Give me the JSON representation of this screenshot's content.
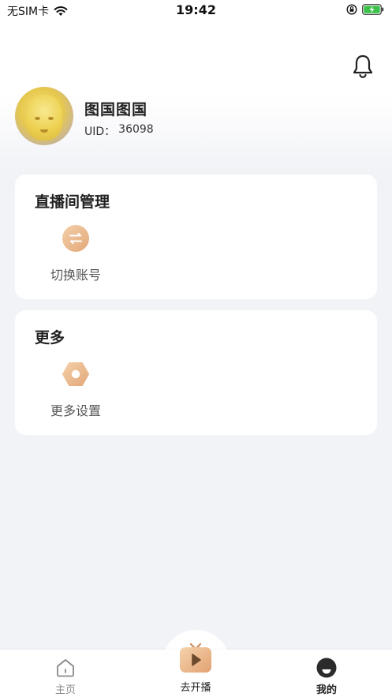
{
  "status_bar": {
    "carrier": "无SIM卡",
    "time": "19:42"
  },
  "profile": {
    "username": "图国图国",
    "uid_label": "UID：",
    "uid_value": "36098"
  },
  "live_management": {
    "title": "直播间管理",
    "items": [
      {
        "label": "切换账号",
        "icon": "switch-account-icon"
      }
    ]
  },
  "more": {
    "title": "更多",
    "items": [
      {
        "label": "更多设置",
        "icon": "settings-hexagon-icon"
      }
    ]
  },
  "tab_bar": {
    "tabs": [
      {
        "label": "主页",
        "icon": "home-icon"
      },
      {
        "label": "去开播",
        "icon": "start-live-tv-icon"
      },
      {
        "label": "我的",
        "icon": "profile-avatar-icon"
      }
    ]
  },
  "colors": {
    "accent": "#e8b88c",
    "page_bg": "#f2f3f7"
  }
}
